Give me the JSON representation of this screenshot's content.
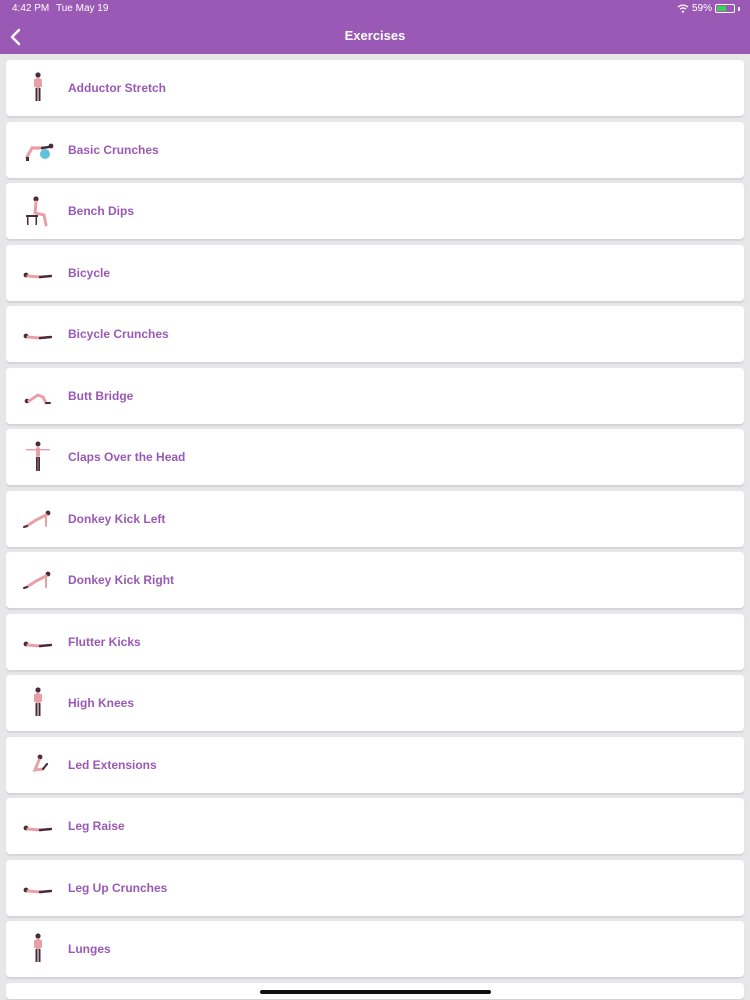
{
  "status": {
    "time": "4:42 PM",
    "date": "Tue May 19",
    "battery": "59%",
    "battery_level": 0.59
  },
  "header": {
    "title": "Exercises",
    "back_icon": "chevron-left-icon"
  },
  "colors": {
    "accent": "#9b59b6",
    "background": "#e7e7e9",
    "figure_skin": "#e8a0a8",
    "figure_dark": "#4a2b3a",
    "ball": "#5fc3d9"
  },
  "exercises": [
    {
      "label": "Adductor Stretch",
      "icon": "standing-figure-icon"
    },
    {
      "label": "Basic Crunches",
      "icon": "ball-crunch-figure-icon"
    },
    {
      "label": "Bench Dips",
      "icon": "bench-dip-figure-icon"
    },
    {
      "label": "Bicycle",
      "icon": "lying-figure-icon"
    },
    {
      "label": "Bicycle Crunches",
      "icon": "lying-figure-icon"
    },
    {
      "label": "Butt Bridge",
      "icon": "bridge-figure-icon"
    },
    {
      "label": "Claps Over the Head",
      "icon": "arms-out-figure-icon"
    },
    {
      "label": "Donkey Kick Left",
      "icon": "plank-figure-icon"
    },
    {
      "label": "Donkey Kick Right",
      "icon": "plank-figure-icon"
    },
    {
      "label": "Flutter Kicks",
      "icon": "lying-figure-icon"
    },
    {
      "label": "High Knees",
      "icon": "standing-figure-icon"
    },
    {
      "label": " Led Extensions",
      "icon": "seated-figure-icon"
    },
    {
      "label": "Leg Raise",
      "icon": "lying-figure-icon"
    },
    {
      "label": "Leg Up Crunches",
      "icon": "lying-figure-icon"
    },
    {
      "label": "Lunges",
      "icon": "standing-figure-icon"
    }
  ]
}
